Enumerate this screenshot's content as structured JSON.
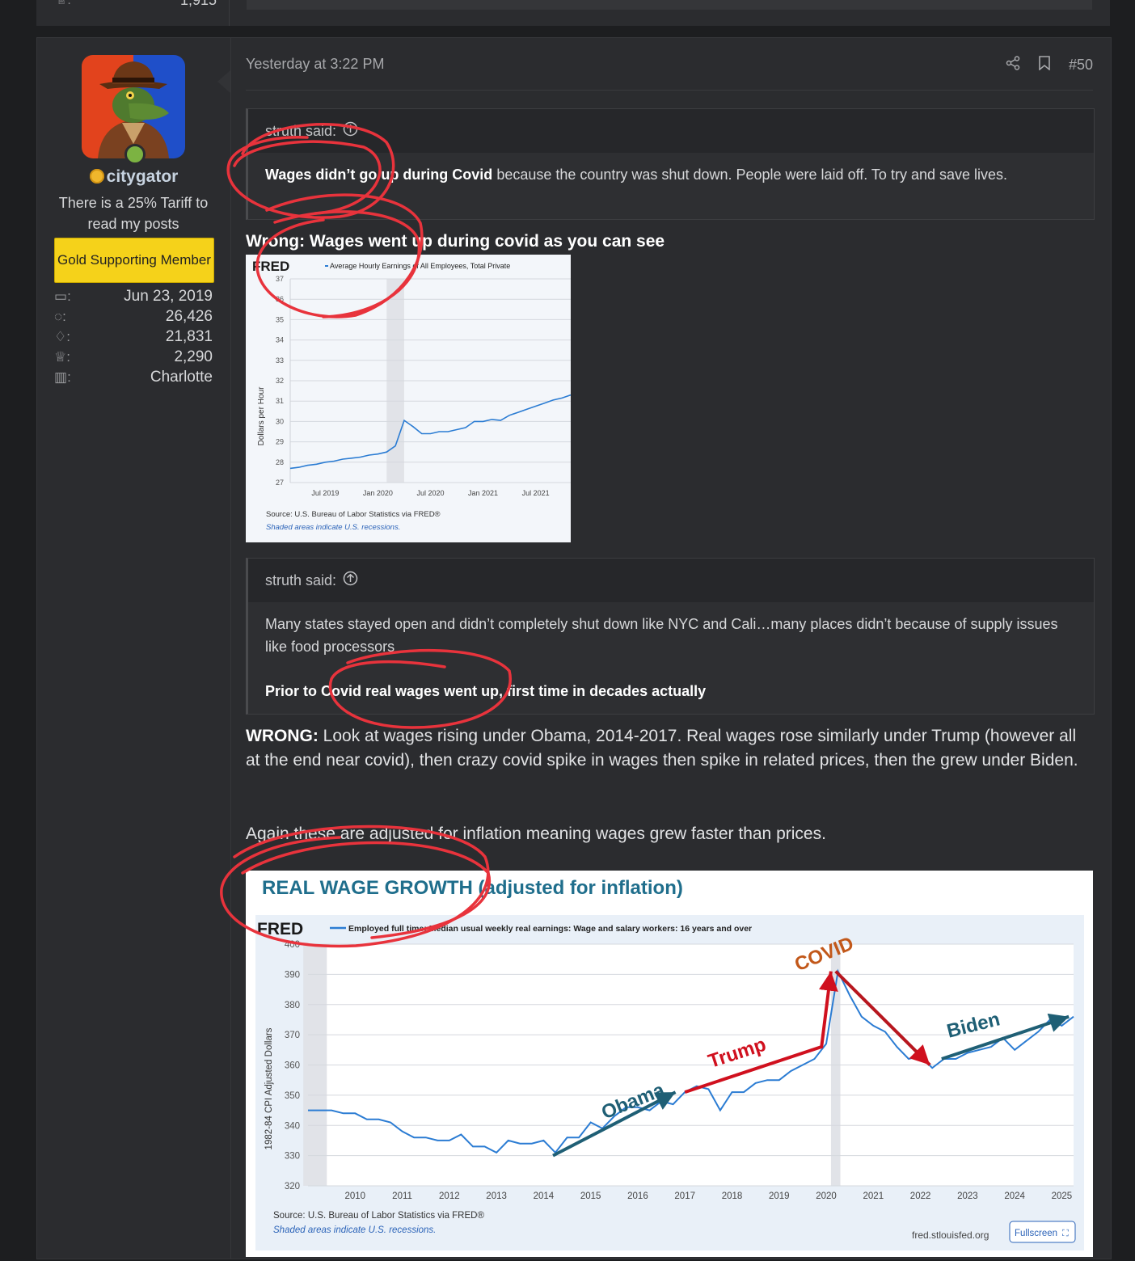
{
  "prev_post": {
    "count": "1,915"
  },
  "user": {
    "name": "citygator",
    "title": "There is a 25% Tariff to read my posts",
    "banner": "Gold Supporting Member",
    "stats": [
      {
        "icon": "calendar-icon",
        "value": "Jun 23, 2019"
      },
      {
        "icon": "messages-icon",
        "value": "26,426"
      },
      {
        "icon": "thumbs-up-icon",
        "value": "21,831"
      },
      {
        "icon": "trophy-icon",
        "value": "2,290"
      },
      {
        "icon": "map-icon",
        "value": "Charlotte"
      }
    ],
    "stat_colon": ":"
  },
  "post": {
    "timestamp": "Yesterday at 3:22 PM",
    "number": "#50",
    "quote1": {
      "author": "struth said:",
      "bold": "Wages didn’t go up during Covid",
      "rest": " because the country was shut down. People were laid off. To try and save lives."
    },
    "reply1": "Wrong: Wages went up during covid as you can see",
    "quote2": {
      "author": "struth said:",
      "line1": "Many states stayed open and didn’t completely shut down like NYC and Cali…many places didn’t because of supply issues like food processors",
      "line2": "Prior to Covid real wages went up, first time in decades actually"
    },
    "reply2_bold": "WRONG:",
    "reply2_rest": " Look at wages rising under Obama, 2014-2017. Real wages rose similarly under Trump (however all at the end near covid), then crazy covid spike in wages then spike in related prices, then the grew under Biden.",
    "reply3": "Again these are adjusted for inflation meaning wages grew faster than prices."
  },
  "chart_data": [
    {
      "type": "line",
      "logo": "FRED",
      "legend": "Average Hourly Earnings of All Employees, Total Private",
      "ylabel": "Dollars per Hour",
      "ylim": [
        27,
        37
      ],
      "yticks": [
        27,
        28,
        29,
        30,
        31,
        32,
        33,
        34,
        35,
        36,
        37
      ],
      "xticks": [
        "Jul 2019",
        "Jan 2020",
        "Jul 2020",
        "Jan 2021",
        "Jul 2021"
      ],
      "series": [
        {
          "x": [
            "2019-03",
            "2019-04",
            "2019-05",
            "2019-06",
            "2019-07",
            "2019-08",
            "2019-09",
            "2019-10",
            "2019-11",
            "2019-12",
            "2020-01",
            "2020-02",
            "2020-03",
            "2020-04",
            "2020-05",
            "2020-06",
            "2020-07",
            "2020-08",
            "2020-09",
            "2020-10",
            "2020-11",
            "2020-12",
            "2021-01",
            "2021-02",
            "2021-03",
            "2021-04",
            "2021-05",
            "2021-06",
            "2021-07",
            "2021-08",
            "2021-09",
            "2021-10",
            "2021-11"
          ],
          "values": [
            27.7,
            27.75,
            27.85,
            27.9,
            28.0,
            28.05,
            28.15,
            28.2,
            28.25,
            28.35,
            28.4,
            28.5,
            28.8,
            30.05,
            29.75,
            29.4,
            29.4,
            29.5,
            29.5,
            29.6,
            29.7,
            30.0,
            30.0,
            30.1,
            30.05,
            30.3,
            30.45,
            30.6,
            30.75,
            30.9,
            31.05,
            31.15,
            31.3
          ]
        }
      ],
      "recession": [
        "2020-02",
        "2020-04"
      ],
      "source": "Source: U.S. Bureau of Labor Statistics via FRED®",
      "note": "Shaded areas indicate U.S. recessions."
    },
    {
      "type": "line",
      "heading": "REAL WAGE GROWTH (adjusted for inflation)",
      "logo": "FRED",
      "legend": "Employed full time: Median usual weekly real earnings: Wage and salary workers: 16 years and over",
      "ylabel": "1982-84 CPI Adjusted Dollars",
      "ylim": [
        320,
        400
      ],
      "yticks": [
        320,
        330,
        340,
        350,
        360,
        370,
        380,
        390,
        400
      ],
      "xticks": [
        "2010",
        "2011",
        "2012",
        "2013",
        "2014",
        "2015",
        "2016",
        "2017",
        "2018",
        "2019",
        "2020",
        "2021",
        "2022",
        "2023",
        "2024",
        "2025"
      ],
      "series": [
        {
          "x": [
            2009.0,
            2009.25,
            2009.5,
            2009.75,
            2010.0,
            2010.25,
            2010.5,
            2010.75,
            2011.0,
            2011.25,
            2011.5,
            2011.75,
            2012.0,
            2012.25,
            2012.5,
            2012.75,
            2013.0,
            2013.25,
            2013.5,
            2013.75,
            2014.0,
            2014.25,
            2014.5,
            2014.75,
            2015.0,
            2015.25,
            2015.5,
            2015.75,
            2016.0,
            2016.25,
            2016.5,
            2016.75,
            2017.0,
            2017.25,
            2017.5,
            2017.75,
            2018.0,
            2018.25,
            2018.5,
            2018.75,
            2019.0,
            2019.25,
            2019.5,
            2019.75,
            2020.0,
            2020.25,
            2020.5,
            2020.75,
            2021.0,
            2021.25,
            2021.5,
            2021.75,
            2022.0,
            2022.25,
            2022.5,
            2022.75,
            2023.0,
            2023.25,
            2023.5,
            2023.75,
            2024.0,
            2024.25,
            2024.5,
            2024.75,
            2025.0,
            2025.25
          ],
          "values": [
            345,
            345,
            345,
            344,
            344,
            342,
            342,
            341,
            338,
            336,
            336,
            335,
            335,
            337,
            333,
            333,
            331,
            335,
            334,
            334,
            335,
            331,
            336,
            336,
            341,
            339,
            343,
            346,
            346,
            345,
            348,
            347,
            351,
            353,
            352,
            345,
            351,
            351,
            354,
            355,
            355,
            358,
            360,
            362,
            367,
            391,
            383,
            376,
            373,
            371,
            366,
            362,
            363,
            359,
            362,
            362,
            364,
            365,
            366,
            369,
            365,
            368,
            371,
            375,
            373,
            376
          ]
        }
      ],
      "recession": [
        2020.1,
        2020.3
      ],
      "recession_left": [
        2008.9,
        2009.4
      ],
      "annotations": [
        "Obama",
        "Trump",
        "COVID",
        "Biden"
      ],
      "source": "Source: U.S. Bureau of Labor Statistics via FRED®",
      "note": "Shaded areas indicate U.S. recessions.",
      "site": "fred.stlouisfed.org",
      "fullscreen": "Fullscreen"
    }
  ]
}
